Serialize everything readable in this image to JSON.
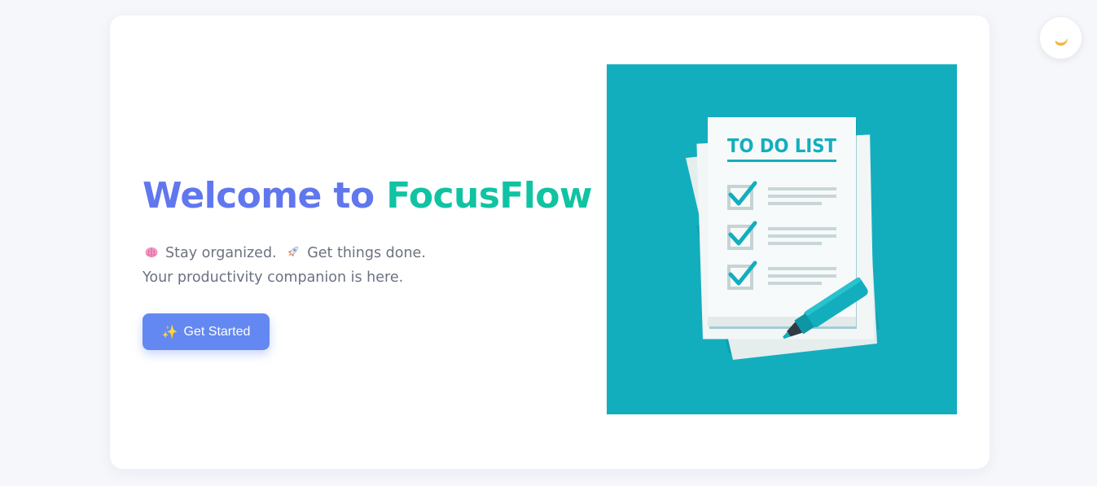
{
  "hero": {
    "title_part1": "Welcome to ",
    "title_part2": "FocusFlow",
    "tagline_line1_a": "Stay organized.",
    "tagline_line1_b": "Get things done.",
    "tagline_line2": "Your productivity companion is here.",
    "cta_label": "Get Started",
    "icons": [
      "brain-icon",
      "rocket-icon",
      "sparkles-icon"
    ]
  },
  "illustration": {
    "heading": "TO DO LIST",
    "checked_items": 3,
    "background_color": "#13aebe"
  },
  "theme_toggle": {
    "icon": "moon-icon"
  },
  "colors": {
    "accent_blue": "#6077ee",
    "accent_green": "#10c3a2",
    "button": "#6488f1",
    "text_muted": "#6b7280"
  }
}
